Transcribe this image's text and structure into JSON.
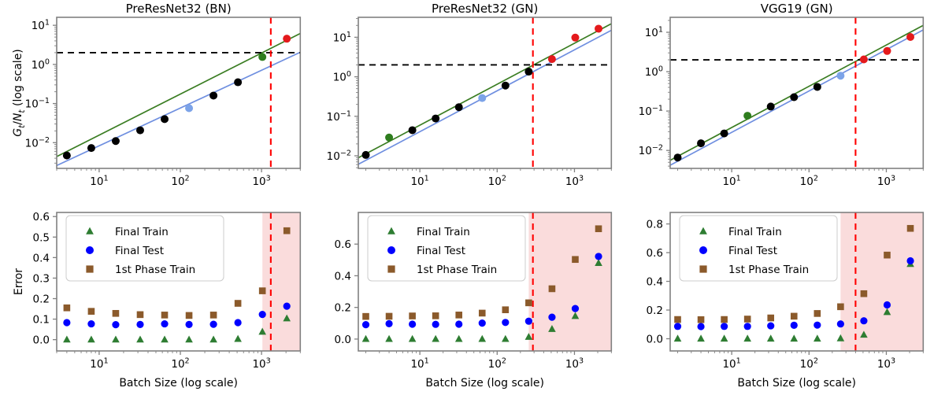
{
  "figure": {
    "columns": 3,
    "rows": 2,
    "background": "#ffffff",
    "spine_color": "#808080"
  },
  "colors": {
    "black": "#000000",
    "red": "#e41a1c",
    "dark_green": "#2e7d1e",
    "line_green": "#3a7d22",
    "line_blue": "#6f8fe0",
    "light_blue": "#7ca3e8",
    "legend_green": "#2e7d32",
    "legend_blue": "#0000ff",
    "legend_brown": "#8b5a2b",
    "shade_pink": "#fadcdc",
    "dashed_black": "#000000",
    "dashed_red": "#ff0000"
  },
  "axis_labels": {
    "y_top": "Gt/Nt (log scale)",
    "y_top_numer": "G",
    "y_top_numer_sub": "t",
    "y_top_denom": "N",
    "y_top_denom_sub": "t",
    "y_top_suffix": " (log scale)",
    "y_bottom": "Error",
    "x_bottom": "Batch Size (log scale)"
  },
  "legend": {
    "entries": [
      {
        "label": "Final Train",
        "marker": "triangle",
        "color": "#2e7d32"
      },
      {
        "label": "Final Test",
        "marker": "circle",
        "color": "#0000ff"
      },
      {
        "label": "1st Phase Train",
        "marker": "square",
        "color": "#8b5a2b"
      }
    ]
  },
  "chart_data": [
    {
      "id": "top-left",
      "type": "scatter",
      "title": "PreResNet32 (BN)",
      "xlabel": "",
      "ylabel": "Gt/Nt (log scale)",
      "xscale": "log",
      "yscale": "log",
      "xlim": [
        3.0,
        3000
      ],
      "ylim": [
        0.0022,
        16
      ],
      "xticks": [
        10,
        100,
        1000
      ],
      "xticklabels": [
        "10^1",
        "10^2",
        "10^3"
      ],
      "yticks": [
        0.01,
        0.1,
        1,
        10
      ],
      "yticklabels": [
        "10^-2",
        "10^-1",
        "10^0",
        "10^1"
      ],
      "grid": false,
      "hline": {
        "y": 2.0,
        "style": "dashed",
        "color": "#000000"
      },
      "vline": {
        "x": 1300,
        "style": "dashed",
        "color": "#ff0000"
      },
      "fit_lines": [
        {
          "name": "green-fit",
          "color": "#3a7d22",
          "x": [
            3.0,
            3000
          ],
          "y": [
            0.0044,
            6.2
          ]
        },
        {
          "name": "blue-fit",
          "color": "#6f8fe0",
          "x": [
            3.0,
            3000
          ],
          "y": [
            0.0026,
            2.05
          ]
        }
      ],
      "points": [
        {
          "x": 4,
          "y": 0.0047,
          "color": "#000000"
        },
        {
          "x": 8,
          "y": 0.0073,
          "color": "#000000"
        },
        {
          "x": 16,
          "y": 0.011,
          "color": "#000000"
        },
        {
          "x": 32,
          "y": 0.0207,
          "color": "#000000"
        },
        {
          "x": 64,
          "y": 0.04,
          "color": "#000000"
        },
        {
          "x": 128,
          "y": 0.076,
          "color": "#7ca3e8"
        },
        {
          "x": 256,
          "y": 0.16,
          "color": "#000000"
        },
        {
          "x": 512,
          "y": 0.35,
          "color": "#000000"
        },
        {
          "x": 1024,
          "y": 1.55,
          "color": "#2e7d1e"
        },
        {
          "x": 2048,
          "y": 4.55,
          "color": "#e41a1c"
        }
      ]
    },
    {
      "id": "top-mid",
      "type": "scatter",
      "title": "PreResNet32 (GN)",
      "xlabel": "",
      "ylabel": "",
      "xscale": "log",
      "yscale": "log",
      "xlim": [
        1.6,
        3000
      ],
      "ylim": [
        0.0048,
        32
      ],
      "xticks": [
        10,
        100,
        1000
      ],
      "xticklabels": [
        "10^1",
        "10^2",
        "10^3"
      ],
      "yticks": [
        0.01,
        0.1,
        1,
        10
      ],
      "yticklabels": [
        "10^-2",
        "10^-1",
        "10^0",
        "10^1"
      ],
      "grid": false,
      "hline": {
        "y": 2.0,
        "style": "dashed",
        "color": "#000000"
      },
      "vline": {
        "x": 290,
        "style": "dashed",
        "color": "#ff0000"
      },
      "fit_lines": [
        {
          "name": "green-fit",
          "color": "#3a7d22",
          "x": [
            1.6,
            3000
          ],
          "y": [
            0.0089,
            22.0
          ]
        },
        {
          "name": "blue-fit",
          "color": "#6f8fe0",
          "x": [
            1.6,
            3000
          ],
          "y": [
            0.0061,
            15.0
          ]
        }
      ],
      "points": [
        {
          "x": 2,
          "y": 0.0105,
          "color": "#000000"
        },
        {
          "x": 4,
          "y": 0.029,
          "color": "#2e7d1e"
        },
        {
          "x": 8,
          "y": 0.0445,
          "color": "#000000"
        },
        {
          "x": 16,
          "y": 0.088,
          "color": "#000000"
        },
        {
          "x": 32,
          "y": 0.17,
          "color": "#000000"
        },
        {
          "x": 64,
          "y": 0.29,
          "color": "#7ca3e8"
        },
        {
          "x": 128,
          "y": 0.6,
          "color": "#000000"
        },
        {
          "x": 256,
          "y": 1.35,
          "color": "#000000"
        },
        {
          "x": 512,
          "y": 2.8,
          "color": "#e41a1c"
        },
        {
          "x": 1024,
          "y": 9.8,
          "color": "#e41a1c"
        },
        {
          "x": 2048,
          "y": 16.5,
          "color": "#e41a1c"
        }
      ]
    },
    {
      "id": "top-right",
      "type": "scatter",
      "title": "VGG19 (GN)",
      "xlabel": "",
      "ylabel": "",
      "xscale": "log",
      "yscale": "log",
      "xlim": [
        1.6,
        3000
      ],
      "ylim": [
        0.0035,
        24
      ],
      "xticks": [
        10,
        100,
        1000
      ],
      "xticklabels": [
        "10^1",
        "10^2",
        "10^3"
      ],
      "yticks": [
        0.01,
        0.1,
        1,
        10
      ],
      "yticklabels": [
        "10^-2",
        "10^-1",
        "10^0",
        "10^1"
      ],
      "grid": false,
      "hline": {
        "y": 2.0,
        "style": "dashed",
        "color": "#000000"
      },
      "vline": {
        "x": 400,
        "style": "dashed",
        "color": "#ff0000"
      },
      "fit_lines": [
        {
          "name": "green-fit",
          "color": "#3a7d22",
          "x": [
            1.6,
            3000
          ],
          "y": [
            0.0056,
            15.0
          ]
        },
        {
          "name": "blue-fit",
          "color": "#6f8fe0",
          "x": [
            1.6,
            3000
          ],
          "y": [
            0.0042,
            11.5
          ]
        }
      ],
      "points": [
        {
          "x": 2,
          "y": 0.0066,
          "color": "#000000"
        },
        {
          "x": 4,
          "y": 0.0152,
          "color": "#000000"
        },
        {
          "x": 8,
          "y": 0.027,
          "color": "#000000"
        },
        {
          "x": 16,
          "y": 0.076,
          "color": "#2e7d1e"
        },
        {
          "x": 32,
          "y": 0.13,
          "color": "#000000"
        },
        {
          "x": 64,
          "y": 0.225,
          "color": "#000000"
        },
        {
          "x": 128,
          "y": 0.41,
          "color": "#000000"
        },
        {
          "x": 256,
          "y": 0.79,
          "color": "#7ca3e8"
        },
        {
          "x": 512,
          "y": 2.05,
          "color": "#e41a1c"
        },
        {
          "x": 1024,
          "y": 3.35,
          "color": "#e41a1c"
        },
        {
          "x": 2048,
          "y": 7.6,
          "color": "#e41a1c"
        }
      ]
    },
    {
      "id": "bottom-left",
      "type": "scatter",
      "title": "",
      "xlabel": "Batch Size (log scale)",
      "ylabel": "Error",
      "xscale": "log",
      "yscale": "linear",
      "xlim": [
        3.0,
        3000
      ],
      "ylim": [
        -0.055,
        0.62
      ],
      "xticks": [
        10,
        100,
        1000
      ],
      "xticklabels": [
        "10^1",
        "10^2",
        "10^3"
      ],
      "yticks": [
        0.0,
        0.1,
        0.2,
        0.3,
        0.4,
        0.5,
        0.6
      ],
      "yticklabels": [
        "0.0",
        "0.1",
        "0.2",
        "0.3",
        "0.4",
        "0.5",
        "0.6"
      ],
      "grid": false,
      "vline": {
        "x": 1300,
        "style": "dashed",
        "color": "#ff0000"
      },
      "shaded_region": {
        "x_start": 1024,
        "x_end": 3000,
        "color": "#fadcdc"
      },
      "series": [
        {
          "name": "Final Train",
          "marker": "triangle",
          "color": "#2e7d32",
          "x": [
            4,
            8,
            16,
            32,
            64,
            128,
            256,
            512,
            1024,
            2048
          ],
          "values": [
            0.0,
            0.0,
            0.0,
            0.0,
            0.0,
            0.0,
            0.0,
            0.003,
            0.038,
            0.103
          ]
        },
        {
          "name": "Final Test",
          "marker": "circle",
          "color": "#0000ff",
          "x": [
            4,
            8,
            16,
            32,
            64,
            128,
            256,
            512,
            1024,
            2048
          ],
          "values": [
            0.083,
            0.077,
            0.073,
            0.074,
            0.077,
            0.074,
            0.075,
            0.083,
            0.123,
            0.163
          ]
        },
        {
          "name": "1st Phase Train",
          "marker": "square",
          "color": "#8b5a2b",
          "x": [
            4,
            8,
            16,
            32,
            64,
            128,
            256,
            512,
            1024,
            2048
          ],
          "values": [
            0.155,
            0.138,
            0.128,
            0.122,
            0.12,
            0.118,
            0.12,
            0.177,
            0.238,
            0.531
          ]
        }
      ]
    },
    {
      "id": "bottom-mid",
      "type": "scatter",
      "title": "",
      "xlabel": "Batch Size (log scale)",
      "ylabel": "",
      "xscale": "log",
      "yscale": "linear",
      "xlim": [
        1.6,
        3000
      ],
      "ylim": [
        -0.075,
        0.8
      ],
      "xticks": [
        10,
        100,
        1000
      ],
      "xticklabels": [
        "10^1",
        "10^2",
        "10^3"
      ],
      "yticks": [
        0.0,
        0.2,
        0.4,
        0.6
      ],
      "yticklabels": [
        "0.0",
        "0.2",
        "0.4",
        "0.6"
      ],
      "grid": false,
      "vline": {
        "x": 290,
        "style": "dashed",
        "color": "#ff0000"
      },
      "shaded_region": {
        "x_start": 256,
        "x_end": 3000,
        "color": "#fadcdc"
      },
      "series": [
        {
          "name": "Final Train",
          "marker": "triangle",
          "color": "#2e7d32",
          "x": [
            2,
            4,
            8,
            16,
            32,
            64,
            128,
            256,
            512,
            1024,
            2048
          ],
          "values": [
            0.0,
            0.0,
            0.0,
            0.0,
            0.0,
            0.0,
            0.0,
            0.013,
            0.063,
            0.145,
            0.48
          ]
        },
        {
          "name": "Final Test",
          "marker": "circle",
          "color": "#0000ff",
          "x": [
            2,
            4,
            8,
            16,
            32,
            64,
            128,
            256,
            512,
            1024,
            2048
          ],
          "values": [
            0.091,
            0.097,
            0.094,
            0.093,
            0.094,
            0.101,
            0.105,
            0.113,
            0.138,
            0.193,
            0.522
          ]
        },
        {
          "name": "1st Phase Train",
          "marker": "square",
          "color": "#8b5a2b",
          "x": [
            2,
            4,
            8,
            16,
            32,
            64,
            128,
            256,
            512,
            1024,
            2048
          ],
          "values": [
            0.143,
            0.144,
            0.146,
            0.147,
            0.152,
            0.164,
            0.185,
            0.229,
            0.318,
            0.503,
            0.697
          ]
        }
      ]
    },
    {
      "id": "bottom-right",
      "type": "scatter",
      "title": "",
      "xlabel": "Batch Size (log scale)",
      "ylabel": "",
      "xscale": "log",
      "yscale": "linear",
      "xlim": [
        1.6,
        3000
      ],
      "ylim": [
        -0.085,
        0.88
      ],
      "xticks": [
        10,
        100,
        1000
      ],
      "xticklabels": [
        "10^1",
        "10^2",
        "10^3"
      ],
      "yticks": [
        0.0,
        0.2,
        0.4,
        0.6,
        0.8
      ],
      "yticklabels": [
        "0.0",
        "0.2",
        "0.4",
        "0.6",
        "0.8"
      ],
      "grid": false,
      "vline": {
        "x": 400,
        "style": "dashed",
        "color": "#ff0000"
      },
      "shaded_region": {
        "x_start": 256,
        "x_end": 3000,
        "color": "#fadcdc"
      },
      "series": [
        {
          "name": "Final Train",
          "marker": "triangle",
          "color": "#2e7d32",
          "x": [
            2,
            4,
            8,
            16,
            32,
            64,
            128,
            256,
            512,
            1024,
            2048
          ],
          "values": [
            0.0,
            0.0,
            0.0,
            0.0,
            0.0,
            0.0,
            0.0,
            0.002,
            0.027,
            0.185,
            0.52
          ]
        },
        {
          "name": "Final Test",
          "marker": "circle",
          "color": "#0000ff",
          "x": [
            2,
            4,
            8,
            16,
            32,
            64,
            128,
            256,
            512,
            1024,
            2048
          ],
          "values": [
            0.086,
            0.085,
            0.086,
            0.086,
            0.09,
            0.094,
            0.095,
            0.103,
            0.125,
            0.236,
            0.543
          ]
        },
        {
          "name": "1st Phase Train",
          "marker": "square",
          "color": "#8b5a2b",
          "x": [
            2,
            4,
            8,
            16,
            32,
            64,
            128,
            256,
            512,
            1024,
            2048
          ],
          "values": [
            0.134,
            0.133,
            0.134,
            0.137,
            0.145,
            0.157,
            0.176,
            0.223,
            0.314,
            0.583,
            0.769
          ]
        }
      ]
    }
  ]
}
